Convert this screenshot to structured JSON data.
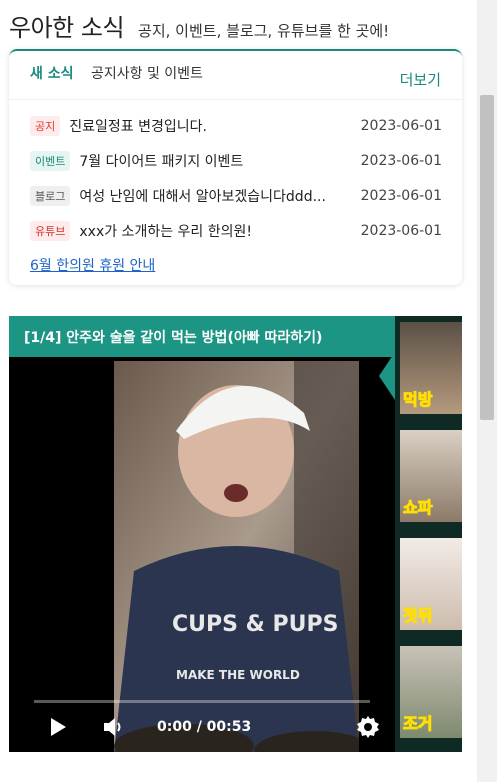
{
  "header": {
    "title": "우아한 소식",
    "subtitle": "공지, 이벤트, 블로그, 유튜브를 한 곳에!"
  },
  "news": {
    "tab_new": "새 소식",
    "tab_notice": "공지사항 및 이벤트",
    "more": "더보기",
    "items": [
      {
        "badge": "공지",
        "title": "진료일정표 변경입니다.",
        "date": "2023-06-01",
        "badge_color": "#e03a2f",
        "badge_bg": "#fdeceb"
      },
      {
        "badge": "이벤트",
        "title": "7월 다이어트 패키지 이벤트",
        "date": "2023-06-01",
        "badge_color": "#1a8a7c",
        "badge_bg": "#e6f4f2"
      },
      {
        "badge": "블로그",
        "title": "여성 난임에 대해서 알아보겠습니다ddd...",
        "date": "2023-06-01",
        "badge_color": "#555555",
        "badge_bg": "#efefef"
      },
      {
        "badge": "유튜브",
        "title": "xxx가 소개하는 우리 한의원!",
        "date": "2023-06-01",
        "badge_color": "#d32f2f",
        "badge_bg": "#fdeceb"
      }
    ],
    "holiday_link": "6월 한의원 휴원 안내"
  },
  "video": {
    "title": "[1/4] 안주와 술을 같이 먹는 방법(아빠 따라하기)",
    "time": "0:00 / 00:53",
    "progress": 0,
    "thumbnails": [
      {
        "caption": "먹방",
        "active": true
      },
      {
        "caption": "쇼파",
        "active": false
      },
      {
        "caption": "첫뒤",
        "active": false
      },
      {
        "caption": "조거",
        "active": false
      }
    ],
    "accent_color": "#1c9585"
  }
}
